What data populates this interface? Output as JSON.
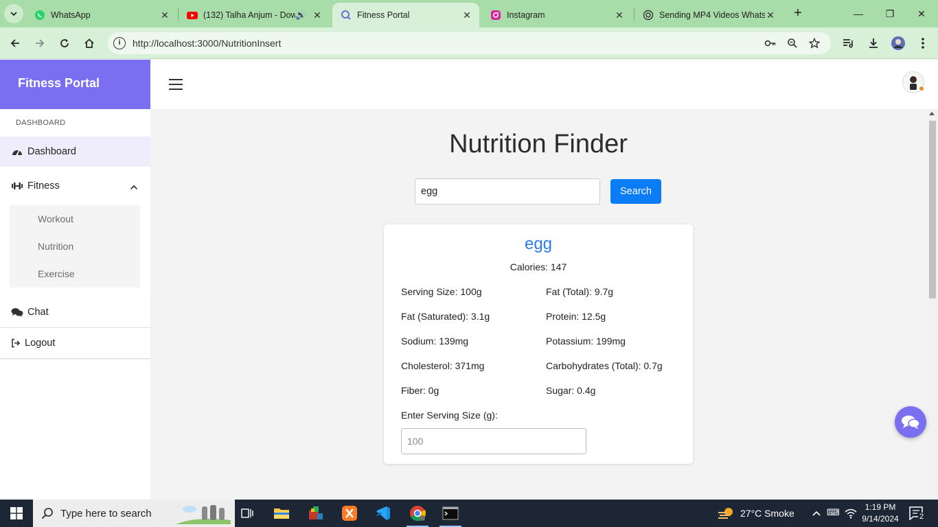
{
  "browser": {
    "tabs": [
      {
        "title": "WhatsApp",
        "icon": "whatsapp-icon",
        "active": false
      },
      {
        "title": "(132) Talha Anjum - Dow",
        "icon": "youtube-icon",
        "active": false
      },
      {
        "title": "Fitness Portal",
        "icon": "portal-icon",
        "active": true
      },
      {
        "title": "Instagram",
        "icon": "instagram-icon",
        "active": false
      },
      {
        "title": "Sending MP4 Videos Whats",
        "icon": "chatgpt-icon",
        "active": false
      }
    ],
    "url": "http://localhost:3000/NutritionInsert"
  },
  "sidebar": {
    "brand": "Fitness Portal",
    "section": "DASHBOARD",
    "dashboard": "Dashboard",
    "fitness": "Fitness",
    "sub_items": [
      "Workout",
      "Nutrition",
      "Exercise"
    ],
    "chat": "Chat",
    "logout": "Logout"
  },
  "main": {
    "title": "Nutrition Finder",
    "search_value": "egg",
    "search_button": "Search"
  },
  "result": {
    "name": "egg",
    "calories": "Calories: 147",
    "nutrients": [
      "Serving Size: 100g",
      "Fat (Total): 9.7g",
      "Fat (Saturated): 3.1g",
      "Protein: 12.5g",
      "Sodium: 139mg",
      "Potassium: 199mg",
      "Cholesterol: 371mg",
      "Carbohydrates (Total): 0.7g",
      "Fiber: 0g",
      "Sugar: 0.4g"
    ],
    "serving_label": "Enter Serving Size (g):",
    "serving_placeholder": "100"
  },
  "taskbar": {
    "search_placeholder": "Type here to search",
    "weather": "27°C  Smoke",
    "time": "1:19 PM",
    "date": "9/14/2024",
    "notifications": "2"
  },
  "colors": {
    "accent": "#7a6ff0",
    "button": "#0a7cf5",
    "result_title": "#2a7de8",
    "chrome_tabstrip": "#a8dca8",
    "chrome_toolbar": "#d7f0d7"
  }
}
